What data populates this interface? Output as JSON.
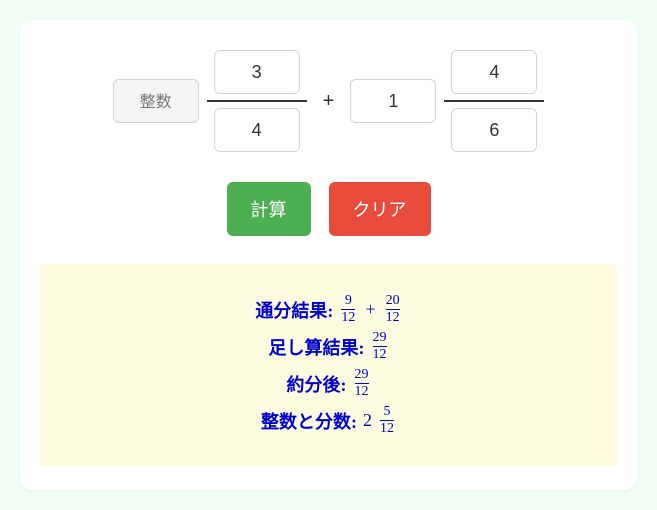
{
  "inputs": {
    "whole1_placeholder": "整数",
    "whole1_value": "",
    "num1": "3",
    "den1": "4",
    "operator": "+",
    "whole2_placeholder": "整数",
    "whole2_value": "1",
    "num2": "4",
    "den2": "6"
  },
  "buttons": {
    "calc": "計算",
    "clear": "クリア"
  },
  "results": {
    "line1": {
      "label": "通分結果:",
      "frac1": {
        "n": "9",
        "d": "12"
      },
      "op": "+",
      "frac2": {
        "n": "20",
        "d": "12"
      }
    },
    "line2": {
      "label": "足し算結果:",
      "frac": {
        "n": "29",
        "d": "12"
      }
    },
    "line3": {
      "label": "約分後:",
      "frac": {
        "n": "29",
        "d": "12"
      }
    },
    "line4": {
      "label": "整数と分数:",
      "whole": "2",
      "frac": {
        "n": "5",
        "d": "12"
      }
    }
  }
}
